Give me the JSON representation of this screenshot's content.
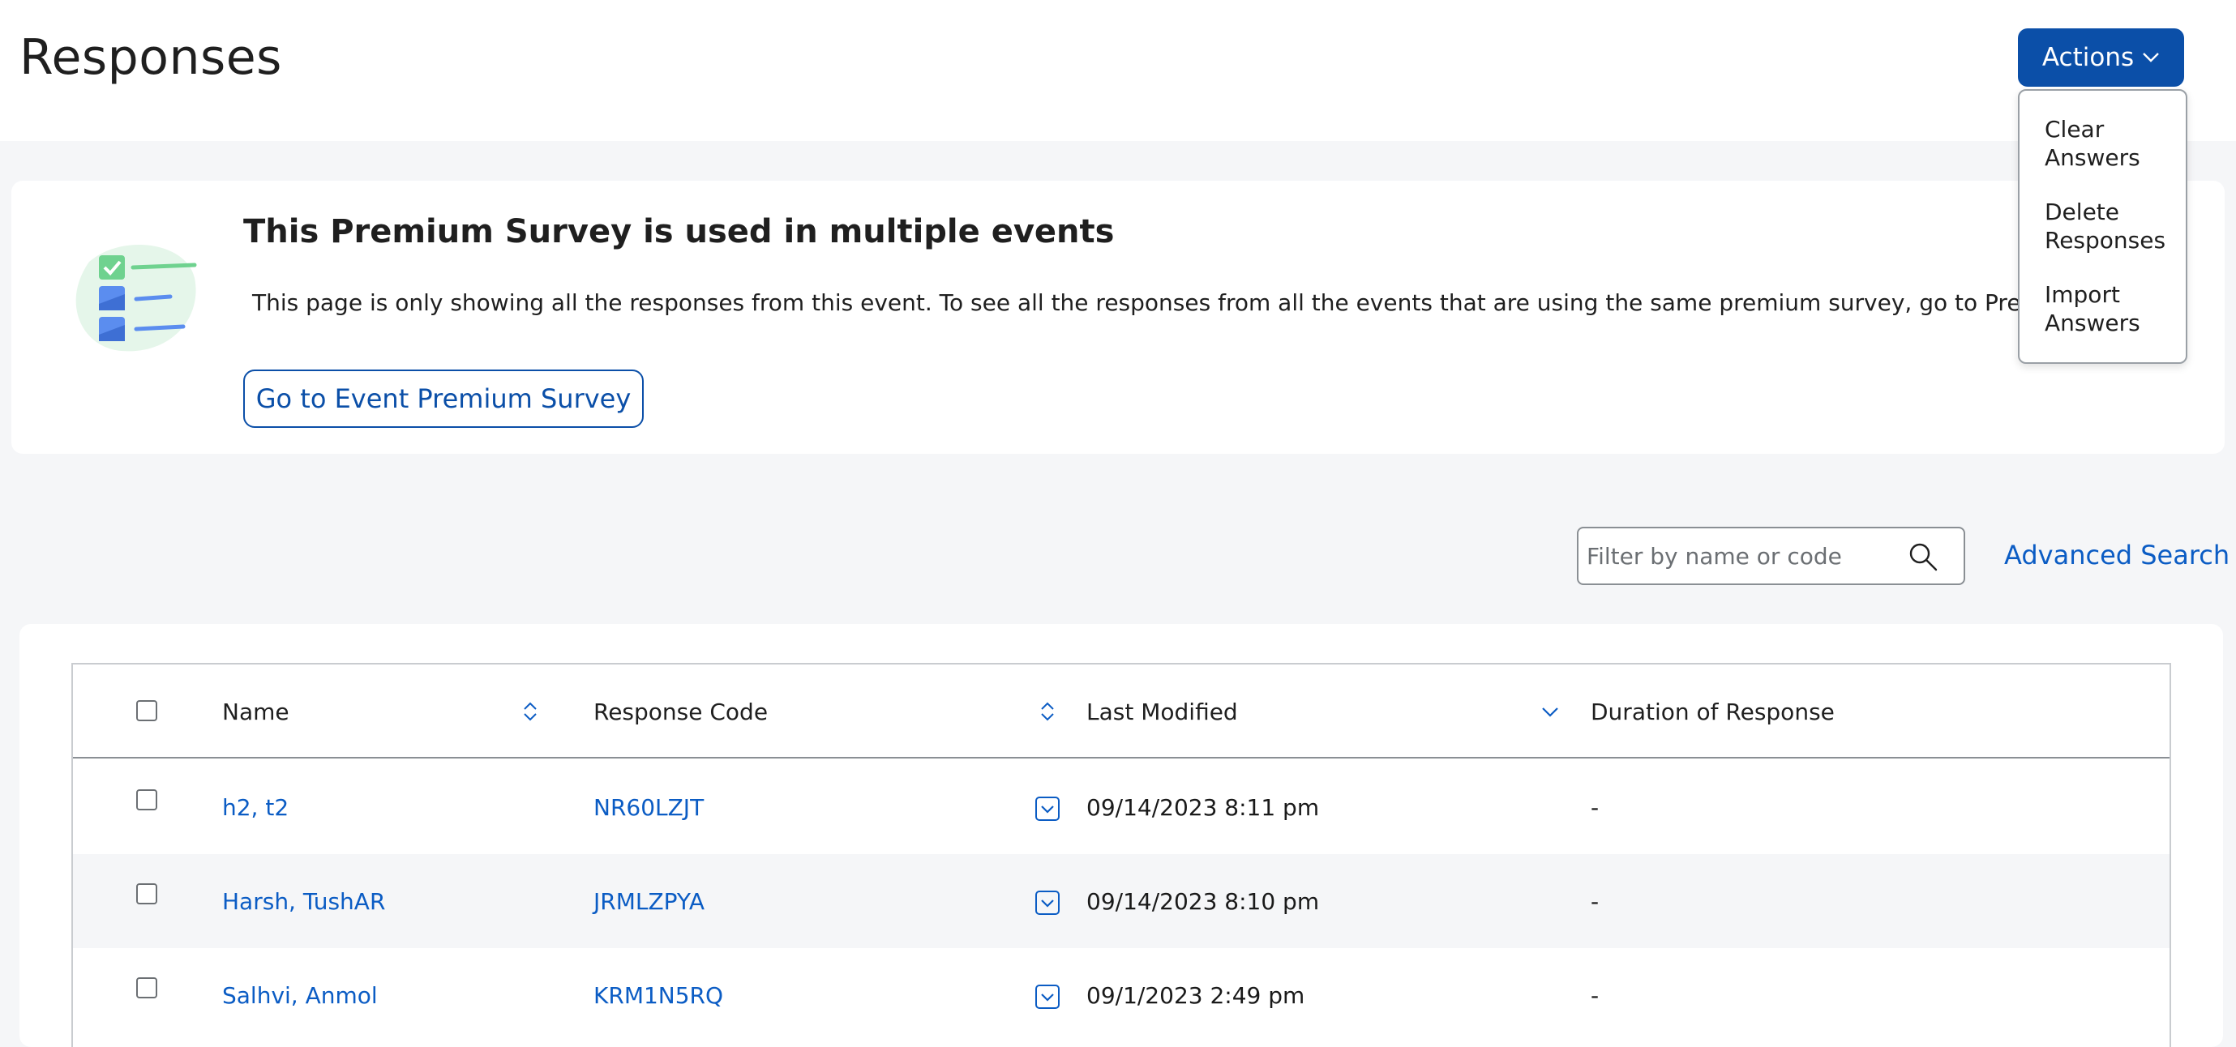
{
  "page": {
    "title": "Responses"
  },
  "actions": {
    "label": "Actions",
    "menu": [
      {
        "id": "clear",
        "line1": "Clear",
        "line2": "Answers"
      },
      {
        "id": "delete",
        "line1": "Delete",
        "line2": "Responses"
      },
      {
        "id": "import",
        "line1": "Import",
        "line2": "Answers"
      }
    ]
  },
  "notice": {
    "title": "This Premium Survey is used in multiple events",
    "body": "This page is only showing all the responses from this event. To see all the responses from all the events that are using the same premium survey, go to Premium surveys",
    "button_label": "Go to Event Premium Survey"
  },
  "search": {
    "placeholder": "Filter by name or code",
    "advanced_label": "Advanced Search"
  },
  "table": {
    "columns": {
      "name": "Name",
      "code": "Response Code",
      "modified": "Last Modified",
      "duration": "Duration of Response"
    },
    "rows": [
      {
        "name": "h2, t2",
        "code": "NR60LZJT",
        "modified": "09/14/2023 8:11 pm",
        "duration": "-"
      },
      {
        "name": "Harsh, TushAR",
        "code": "JRMLZPYA",
        "modified": "09/14/2023 8:10 pm",
        "duration": "-"
      },
      {
        "name": "Salhvi, Anmol",
        "code": "KRM1N5RQ",
        "modified": "09/1/2023 2:49 pm",
        "duration": "-"
      }
    ]
  },
  "colors": {
    "primary": "#0b4fa8",
    "link": "#0b5cc4",
    "background": "#f5f6f8"
  }
}
